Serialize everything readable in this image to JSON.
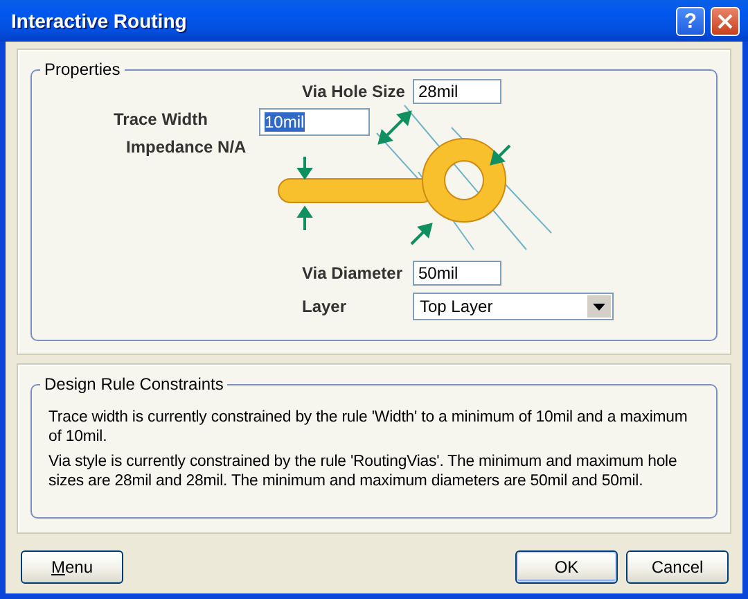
{
  "window": {
    "title": "Interactive Routing",
    "help_button": "?"
  },
  "properties": {
    "title": "Properties",
    "via_hole_size": {
      "label": "Via Hole Size",
      "value": "28mil"
    },
    "trace_width": {
      "label": "Trace Width",
      "value": "10mil",
      "highlighted": true
    },
    "impedance": "Impedance N/A",
    "via_diameter": {
      "label": "Via Diameter",
      "value": "50mil"
    },
    "layer": {
      "label": "Layer",
      "value": "Top Layer"
    }
  },
  "design_rule_constraints": {
    "title": "Design Rule Constraints",
    "paragraphs": [
      "Trace width is currently constrained by the rule 'Width' to a minimum of 10mil and a maximum of 10mil.",
      "Via style is currently constrained by the rule 'RoutingVias'. The minimum and maximum hole sizes are 28mil and 28mil. The minimum and maximum diameters are 50mil and 50mil."
    ]
  },
  "buttons": [
    {
      "label": "Menu",
      "mnemonic": true,
      "default": false
    },
    {
      "label": "OK",
      "mnemonic": false,
      "default": true
    },
    {
      "label": "Cancel",
      "mnemonic": false,
      "default": false
    }
  ]
}
